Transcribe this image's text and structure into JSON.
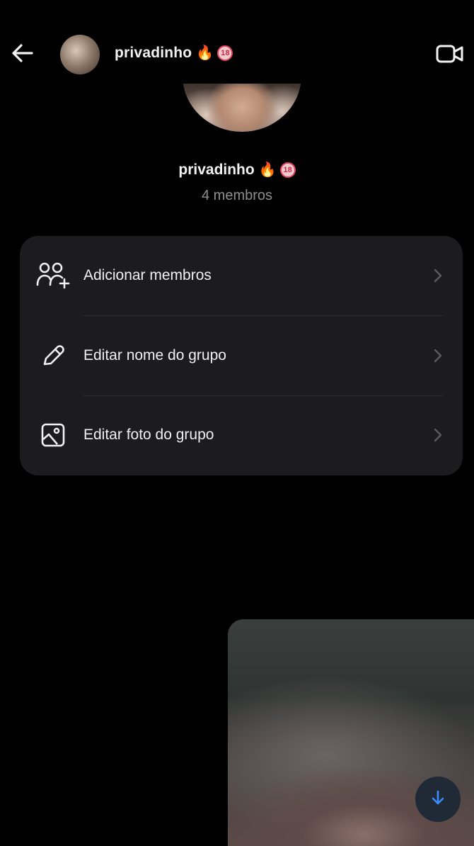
{
  "header": {
    "title": "privadinho",
    "title_emoji": "🔥",
    "age_badge": "18",
    "back_icon": "arrow-left-icon",
    "video_icon": "video-camera-icon"
  },
  "group": {
    "name": "privadinho",
    "name_emoji": "🔥",
    "age_badge": "18",
    "members": "4 membros"
  },
  "options": [
    {
      "label": "Adicionar membros",
      "icon": "add-members-icon"
    },
    {
      "label": "Editar nome do grupo",
      "icon": "pencil-icon"
    },
    {
      "label": "Editar foto do grupo",
      "icon": "image-icon"
    }
  ],
  "colors": {
    "background": "#000000",
    "card": "#1c1c1e",
    "muted_text": "#8e8e8e",
    "scroll_button_arrow": "#3d8bfd"
  }
}
